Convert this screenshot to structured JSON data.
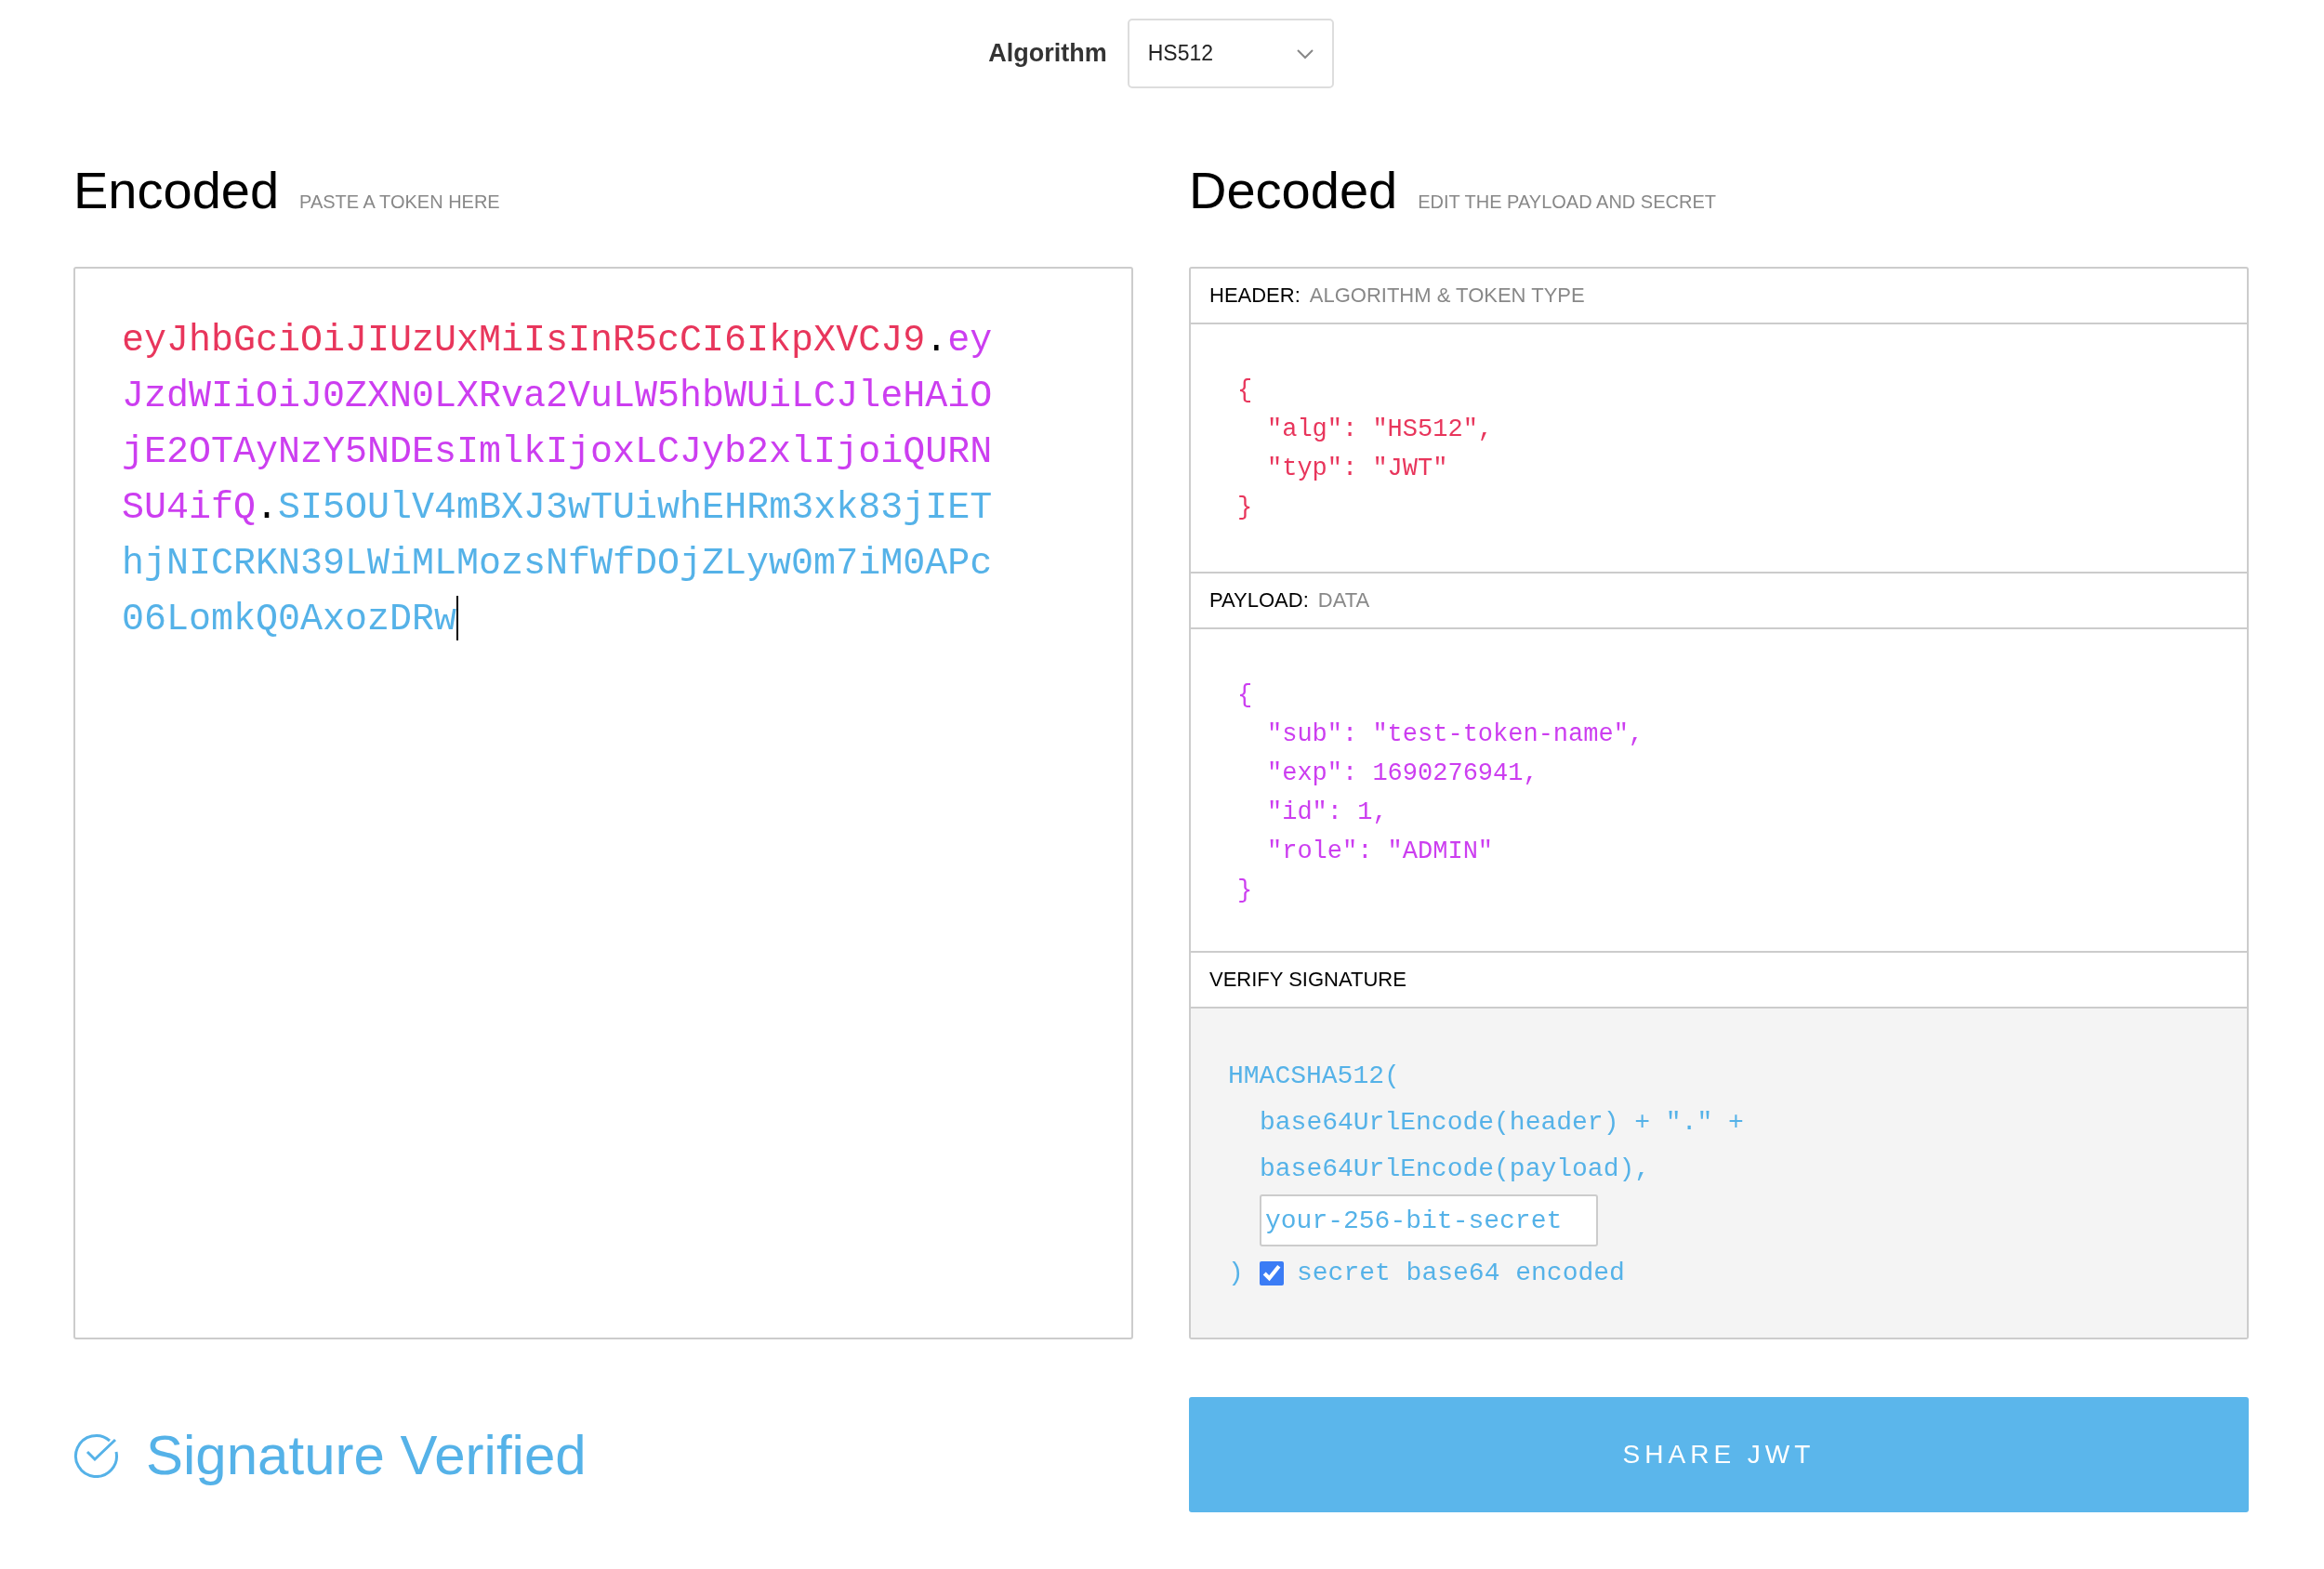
{
  "algorithm": {
    "label": "Algorithm",
    "value": "HS512"
  },
  "encoded": {
    "title": "Encoded",
    "hint": "PASTE A TOKEN HERE",
    "parts": [
      {
        "kind": "header",
        "text": "eyJhbGciOiJIUzUxMiIsInR5cCI6IkpXVCJ9"
      },
      {
        "kind": "separator",
        "text": "."
      },
      {
        "kind": "payload",
        "text": "eyJzdWIiOiJ0ZXN0LXRva2VuLW5hbWUiLCJleHAiOjE2OTAyNzY5NDEsImlkIjoxLCJyb2xlIjoiQURNSU4ifQ"
      },
      {
        "kind": "separator",
        "text": "."
      },
      {
        "kind": "signature",
        "text": "SI5OUlV4mBXJ3wTUiwhEHRm3xk83jIEThjNICRKN39LWiMLMozsNfWfDOjZLyw0m7iM0APc06LomkQ0AxozDRw"
      }
    ]
  },
  "decoded": {
    "title": "Decoded",
    "hint": "EDIT THE PAYLOAD AND SECRET",
    "header": {
      "label": "HEADER:",
      "sublabel": "ALGORITHM & TOKEN TYPE",
      "lines": [
        {
          "kind": "brace",
          "text": "{"
        },
        {
          "kind": "entry",
          "text": "\"alg\": \"HS512\","
        },
        {
          "kind": "entry",
          "text": "\"typ\": \"JWT\""
        },
        {
          "kind": "brace",
          "text": "}"
        }
      ]
    },
    "payload": {
      "label": "PAYLOAD:",
      "sublabel": "DATA",
      "lines": [
        {
          "kind": "brace",
          "text": "{"
        },
        {
          "kind": "entry",
          "text": "\"sub\": \"test-token-name\","
        },
        {
          "kind": "entry",
          "text": "\"exp\": 1690276941,"
        },
        {
          "kind": "entry",
          "text": "\"id\": 1,"
        },
        {
          "kind": "entry",
          "text": "\"role\": \"ADMIN\""
        },
        {
          "kind": "brace",
          "text": "}"
        }
      ]
    },
    "verify": {
      "label": "VERIFY SIGNATURE",
      "function": "HMACSHA512(",
      "args": [
        "base64UrlEncode(header) + \".\" +",
        "base64UrlEncode(payload),"
      ],
      "secret": "your-256-bit-secret",
      "close": ")",
      "checkbox": {
        "label": "secret base64 encoded",
        "checked": true
      }
    }
  },
  "status": {
    "text": "Signature Verified",
    "verified": true
  },
  "share_button": "SHARE JWT"
}
